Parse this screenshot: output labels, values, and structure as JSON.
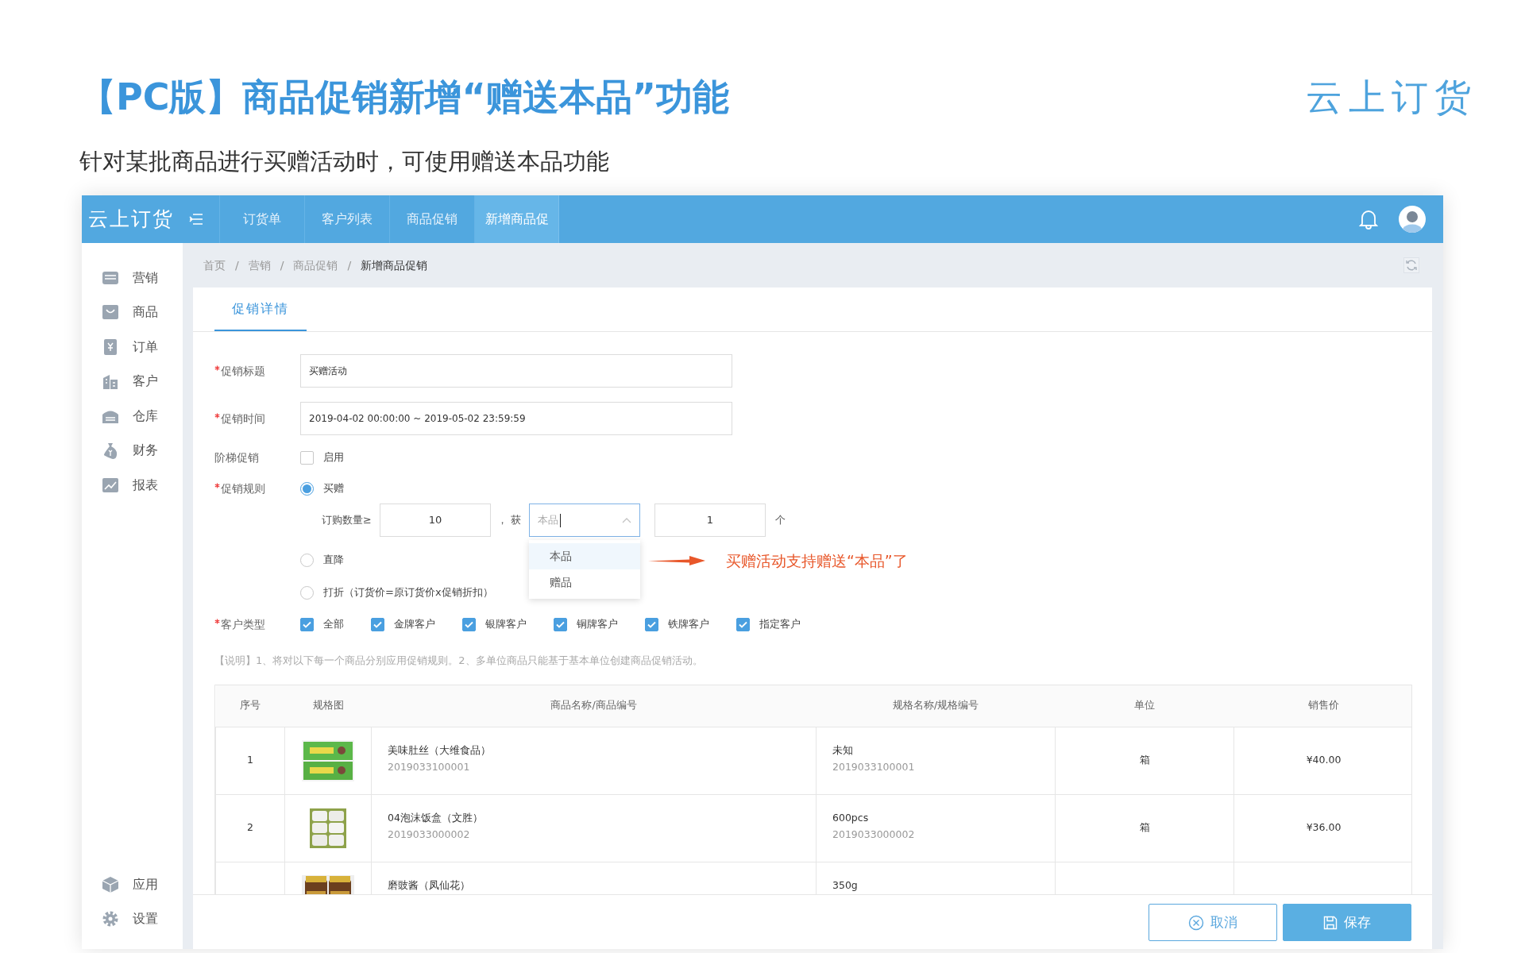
{
  "slide": {
    "title": "【PC版】商品促销新增“赠送本品”功能",
    "subtitle": "针对某批商品进行买赠活动时，可使用赠送本品功能",
    "brand": "云上订货"
  },
  "app": {
    "logo": "云上订货",
    "nav_tabs": [
      {
        "label": "订货单",
        "selected": false
      },
      {
        "label": "客户列表",
        "selected": false
      },
      {
        "label": "商品促销",
        "selected": false
      },
      {
        "label": "新增商品促",
        "selected": true
      }
    ],
    "sidebar": {
      "items": [
        {
          "label": "营销"
        },
        {
          "label": "商品"
        },
        {
          "label": "订单"
        },
        {
          "label": "客户"
        },
        {
          "label": "仓库"
        },
        {
          "label": "财务"
        },
        {
          "label": "报表"
        }
      ],
      "bottom_items": [
        {
          "label": "应用"
        },
        {
          "label": "设置"
        }
      ]
    },
    "breadcrumb": [
      {
        "label": "首页",
        "current": false,
        "separator": "/"
      },
      {
        "label": "营销",
        "current": false,
        "separator": "/"
      },
      {
        "label": "商品促销",
        "current": false,
        "separator": "/"
      },
      {
        "label": "新增商品促销",
        "current": true
      }
    ],
    "page_tabs": [
      {
        "label": "促销详情",
        "selected": true
      }
    ],
    "form": {
      "title_field": {
        "label": "促销标题",
        "required": true,
        "value": "买赠活动"
      },
      "time_field": {
        "label": "促销时间",
        "required": true,
        "value": "2019-04-02 00:00:00 ~ 2019-05-02 23:59:59"
      },
      "tiered": {
        "label": "阶梯促销",
        "required": false,
        "option": {
          "label": "启用",
          "checked": false
        }
      },
      "rule": {
        "label": "促销规则",
        "required": true,
        "options": [
          {
            "kind": "buy_gift",
            "label": "买赠",
            "selected": true
          },
          {
            "kind": "plain",
            "label": "直降",
            "selected": false
          },
          {
            "kind": "plain",
            "label": "打折（订货价=原订货价x促销折扣）",
            "selected": false
          }
        ],
        "buy_gift": {
          "qty_label": "订购数量≥",
          "qty_value": "10",
          "comma": "，",
          "get_label": "获",
          "gift_select": {
            "placeholder": "本品",
            "expanded": true,
            "options": [
              {
                "label": "本品",
                "selected": true
              },
              {
                "label": "赠品",
                "selected": false
              }
            ]
          },
          "gift_qty": "1",
          "unit": "个"
        }
      },
      "customer_types": {
        "label": "客户类型",
        "required": true,
        "options": [
          {
            "label": "全部",
            "checked": true
          },
          {
            "label": "金牌客户",
            "checked": true
          },
          {
            "label": "银牌客户",
            "checked": true
          },
          {
            "label": "铜牌客户",
            "checked": true
          },
          {
            "label": "铁牌客户",
            "checked": true
          },
          {
            "label": "指定客户",
            "checked": true
          }
        ]
      },
      "note": "【说明】1、将对以下每一个商品分别应用促销规则。2、多单位商品只能基于基本单位创建商品促销活动。"
    },
    "annotation": "买赠活动支持赠送“本品”了",
    "table": {
      "columns": [
        "序号",
        "规格图",
        "商品名称/商品编号",
        "规格名称/规格编号",
        "单位",
        "销售价"
      ],
      "rows": [
        {
          "no": "1",
          "name": "美味肚丝（大维食品）",
          "code": "2019033100001",
          "spec": "未知",
          "spec_code": "2019033100001",
          "unit": "箱",
          "price": "¥40.00"
        },
        {
          "no": "2",
          "name": "04泡沫饭盒（文胜）",
          "code": "2019033000002",
          "spec": "600pcs",
          "spec_code": "2019033000002",
          "unit": "箱",
          "price": "¥36.00"
        },
        {
          "name": "磨豉酱（凤仙花）",
          "spec": "350g"
        }
      ]
    },
    "buttons": [
      {
        "kind": "secondary",
        "label": "取消"
      },
      {
        "kind": "primary",
        "label": "保存"
      }
    ]
  }
}
